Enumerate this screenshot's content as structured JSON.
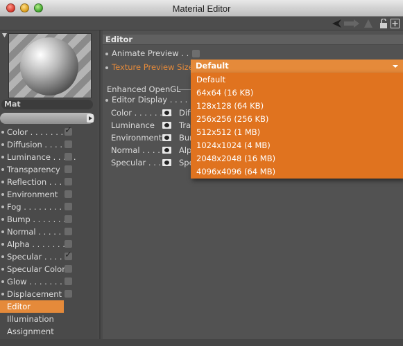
{
  "window": {
    "title": "Material Editor"
  },
  "material": {
    "name": "Mat"
  },
  "channels": [
    {
      "label": "Color . . . . . . . .",
      "checked": true
    },
    {
      "label": "Diffusion . . . . . .",
      "checked": false
    },
    {
      "label": "Luminance . . . . .",
      "checked": false
    },
    {
      "label": "Transparency",
      "checked": false
    },
    {
      "label": "Reflection . . . .",
      "checked": false
    },
    {
      "label": "Environment",
      "checked": false
    },
    {
      "label": "Fog . . . . . . . . .",
      "checked": false
    },
    {
      "label": "Bump . . . . . . . .",
      "checked": false
    },
    {
      "label": "Normal . . . . . . .",
      "checked": false
    },
    {
      "label": "Alpha . . . . . . . .",
      "checked": false
    },
    {
      "label": "Specular . . . . .",
      "checked": true
    },
    {
      "label": "Specular Color",
      "checked": false
    },
    {
      "label": "Glow . . . . . . . .",
      "checked": false
    },
    {
      "label": "Displacement",
      "checked": false
    }
  ],
  "extra_items": [
    "Editor",
    "Illumination",
    "Assignment"
  ],
  "editor": {
    "section_title": "Editor",
    "animate_preview_label": "Animate Preview . . . .",
    "texture_preview_size_label": "Texture Preview Size",
    "texture_preview_size_value": "Default",
    "enhanced_opengl_label": "Enhanced OpenGL",
    "editor_display_label": "Editor Display . . . . . . .",
    "display_rows": [
      {
        "left": "Color . . . . . . . .",
        "right": "Diff"
      },
      {
        "left": "Luminance",
        "right": "Tra"
      },
      {
        "left": "Environment",
        "right": "Bur"
      },
      {
        "left": "Normal . . . . .",
        "right": "Alp"
      },
      {
        "left": "Specular . . . . .",
        "right": "Spe"
      }
    ]
  },
  "dropdown_options": [
    "Default",
    "64x64 (16 KB)",
    "128x128 (64 KB)",
    "256x256 (256 KB)",
    "512x512 (1 MB)",
    "1024x1024 (4 MB)",
    "2048x2048 (16 MB)",
    "4096x4096 (64 MB)"
  ],
  "colors": {
    "accent": "#e58a3a",
    "menu": "#e0731f",
    "panel": "#525252"
  }
}
